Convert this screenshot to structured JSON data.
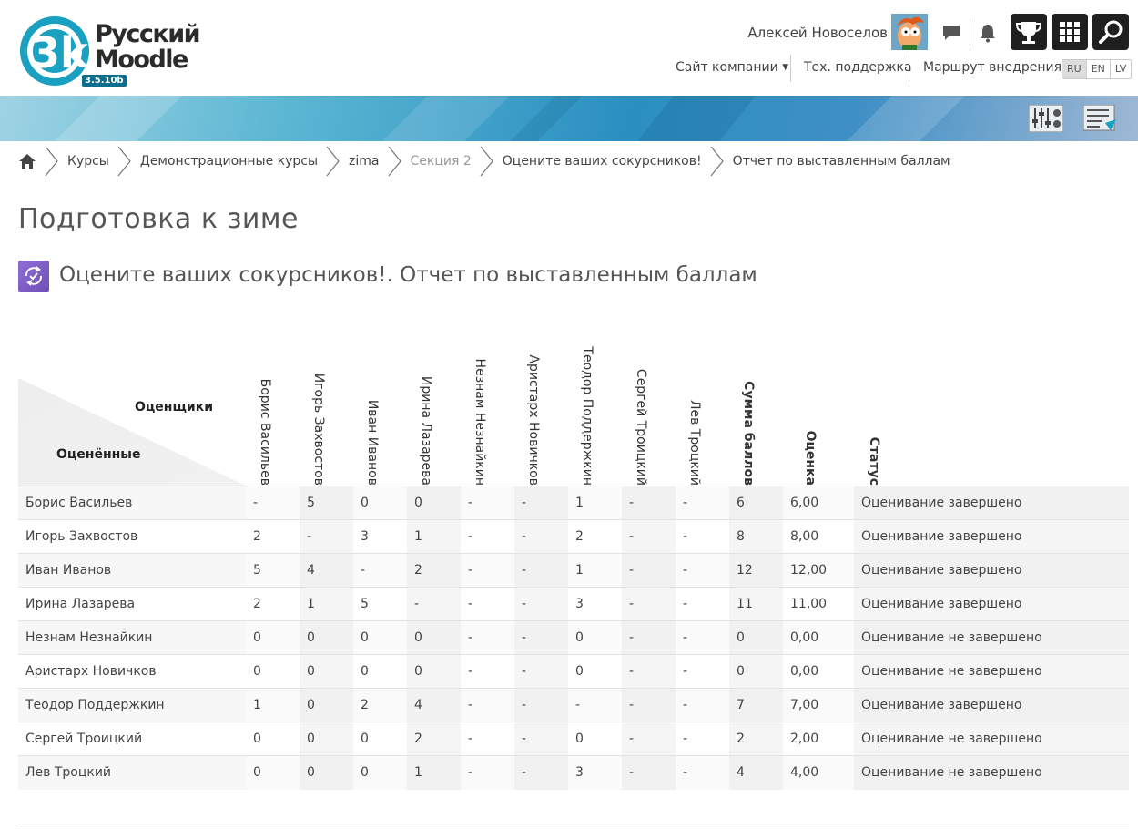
{
  "header": {
    "logo_line1": "Русский",
    "logo_line2": "Moodle",
    "logo_version": "3.5.10b",
    "user_name": "Алексей Новоселов",
    "nav": [
      "Сайт компании",
      "Тех. поддержка",
      "Маршрут внедрения"
    ],
    "languages": [
      "RU",
      "EN",
      "LV"
    ],
    "icons": [
      "message-icon",
      "bell-icon",
      "trophy-icon",
      "grid-icon",
      "search-icon"
    ]
  },
  "breadcrumb": [
    "Курсы",
    "Демонстрационные курсы",
    "zima",
    "Секция 2",
    "Оцените ваших сокурсников!",
    "Отчет по выставленным баллам"
  ],
  "main": {
    "title": "Подготовка к зиме",
    "activity_title": "Оцените ваших сокурсников!. Отчет по выставленным баллам"
  },
  "table": {
    "corner_top": "Оценщики",
    "corner_bottom": "Оценённые",
    "columns": [
      "Борис Васильев",
      "Игорь Захвостов",
      "Иван Иванов",
      "Ирина Лазарева",
      "Незнам Незнайкин",
      "Аристарх Новичков",
      "Теодор Поддержкин",
      "Сергей Троицкий",
      "Лев Троцкий",
      "Сумма баллов",
      "Оценка",
      "Статус"
    ],
    "rows": [
      {
        "name": "Борис Васильев",
        "scores": [
          "-",
          "5",
          "0",
          "0",
          "-",
          "-",
          "1",
          "-",
          "-"
        ],
        "sum": "6",
        "grade": "6,00",
        "status": "Оценивание завершено"
      },
      {
        "name": "Игорь Захвостов",
        "scores": [
          "2",
          "-",
          "3",
          "1",
          "-",
          "-",
          "2",
          "-",
          "-"
        ],
        "sum": "8",
        "grade": "8,00",
        "status": "Оценивание завершено"
      },
      {
        "name": "Иван Иванов",
        "scores": [
          "5",
          "4",
          "-",
          "2",
          "-",
          "-",
          "1",
          "-",
          "-"
        ],
        "sum": "12",
        "grade": "12,00",
        "status": "Оценивание завершено"
      },
      {
        "name": "Ирина Лазарева",
        "scores": [
          "2",
          "1",
          "5",
          "-",
          "-",
          "-",
          "3",
          "-",
          "-"
        ],
        "sum": "11",
        "grade": "11,00",
        "status": "Оценивание завершено"
      },
      {
        "name": "Незнам Незнайкин",
        "scores": [
          "0",
          "0",
          "0",
          "0",
          "-",
          "-",
          "0",
          "-",
          "-"
        ],
        "sum": "0",
        "grade": "0,00",
        "status": "Оценивание не завершено"
      },
      {
        "name": "Аристарх Новичков",
        "scores": [
          "0",
          "0",
          "0",
          "0",
          "-",
          "-",
          "0",
          "-",
          "-"
        ],
        "sum": "0",
        "grade": "0,00",
        "status": "Оценивание не завершено"
      },
      {
        "name": "Теодор Поддержкин",
        "scores": [
          "1",
          "0",
          "2",
          "4",
          "-",
          "-",
          "-",
          "-",
          "-"
        ],
        "sum": "7",
        "grade": "7,00",
        "status": "Оценивание завершено"
      },
      {
        "name": "Сергей Троицкий",
        "scores": [
          "0",
          "0",
          "0",
          "2",
          "-",
          "-",
          "0",
          "-",
          "-"
        ],
        "sum": "2",
        "grade": "2,00",
        "status": "Оценивание не завершено"
      },
      {
        "name": "Лев Троцкий",
        "scores": [
          "0",
          "0",
          "0",
          "1",
          "-",
          "-",
          "3",
          "-",
          "-"
        ],
        "sum": "4",
        "grade": "4,00",
        "status": "Оценивание не завершено"
      }
    ]
  },
  "colors": {
    "accent": "#0b6e8f",
    "logo_teal": "#1aa0c0",
    "activity_icon": "#7a5cc6"
  }
}
